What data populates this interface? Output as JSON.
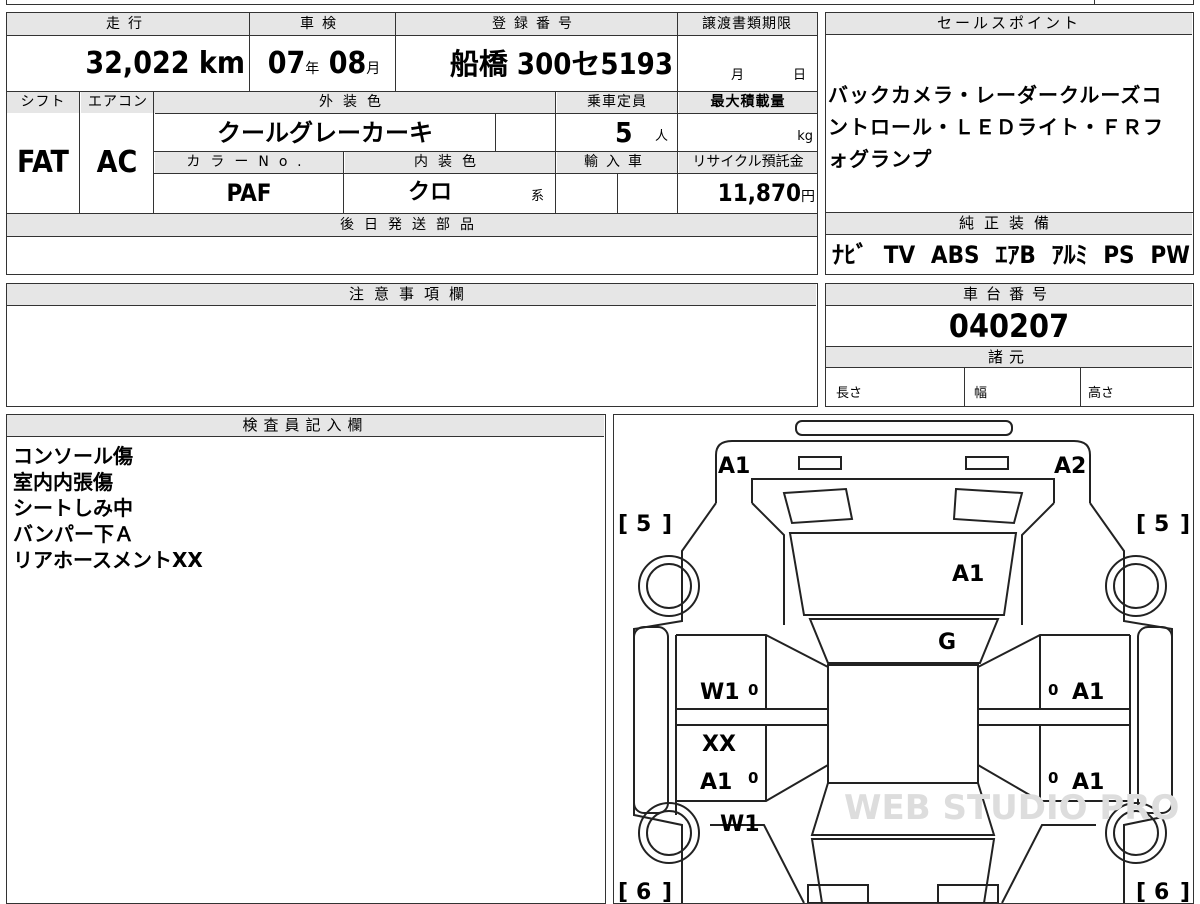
{
  "top_info": {
    "mileage_label": "走行",
    "mileage_value": "32,022",
    "mileage_unit": "km",
    "inspection_label": "車検",
    "inspection_year": "07",
    "inspection_year_unit": "年",
    "inspection_month": "08",
    "inspection_month_unit": "月",
    "registration_label": "登録番号",
    "registration_value": "船橋 300セ5193",
    "transfer_deadline_label": "譲渡書類期限",
    "transfer_month_unit": "月",
    "transfer_day_unit": "日",
    "shift_label": "シフト",
    "shift_value": "FAT",
    "aircon_label": "エアコン",
    "aircon_value": "AC",
    "exterior_color_label": "外装色",
    "exterior_color_value": "クールグレーカーキ",
    "capacity_label": "乗車定員",
    "capacity_value": "5",
    "capacity_unit": "人",
    "max_load_label": "最大積載量",
    "max_load_unit": "kg",
    "color_no_label": "カラーNo.",
    "color_no_value": "PAF",
    "interior_color_label": "内装色",
    "interior_color_value": "クロ",
    "interior_color_suffix": "系",
    "import_label": "輸入車",
    "recycle_label": "リサイクル預託金",
    "recycle_value": "11,870",
    "recycle_unit": "円",
    "parts_label": "後日発送部品"
  },
  "sales_point": {
    "label": "セールスポイント",
    "text": "バックカメラ・レーダークルーズコントロール・ＬＥＤライト・ＦＲフォグランプ"
  },
  "equipment": {
    "label": "純正装備",
    "items": [
      "ﾅﾋﾞ",
      "TV",
      "ABS",
      "ｴｱB",
      "ｱﾙﾐ",
      "PS",
      "PW"
    ]
  },
  "notes": {
    "label": "注意事項欄"
  },
  "chassis": {
    "label": "車台番号",
    "value": "040207"
  },
  "specs": {
    "label": "諸元",
    "length_label": "長さ",
    "width_label": "幅",
    "height_label": "高さ"
  },
  "inspector": {
    "label": "検査員記入欄",
    "lines": [
      "コンソール傷",
      "室内内張傷",
      "シートしみ中",
      "バンパー下Ａ",
      "リアホースメントXX"
    ]
  },
  "diagram": {
    "marks": {
      "front_left": "A1",
      "front_right": "A2",
      "hood": "A1",
      "windshield": "G",
      "left_front_door": "W1",
      "left_front_door_num": "0",
      "right_front_door": "A1",
      "right_front_door_num": "0",
      "left_pillar": "XX",
      "left_rear_door": "A1",
      "left_rear_door_num": "0",
      "right_rear_door": "A1",
      "right_rear_door_num": "0",
      "left_rear_fender": "W1",
      "tire_front_left": "5",
      "tire_front_right": "5",
      "tire_rear_left": "6",
      "tire_rear_right": "6"
    },
    "watermark": "WEB STUDIO PRO"
  }
}
